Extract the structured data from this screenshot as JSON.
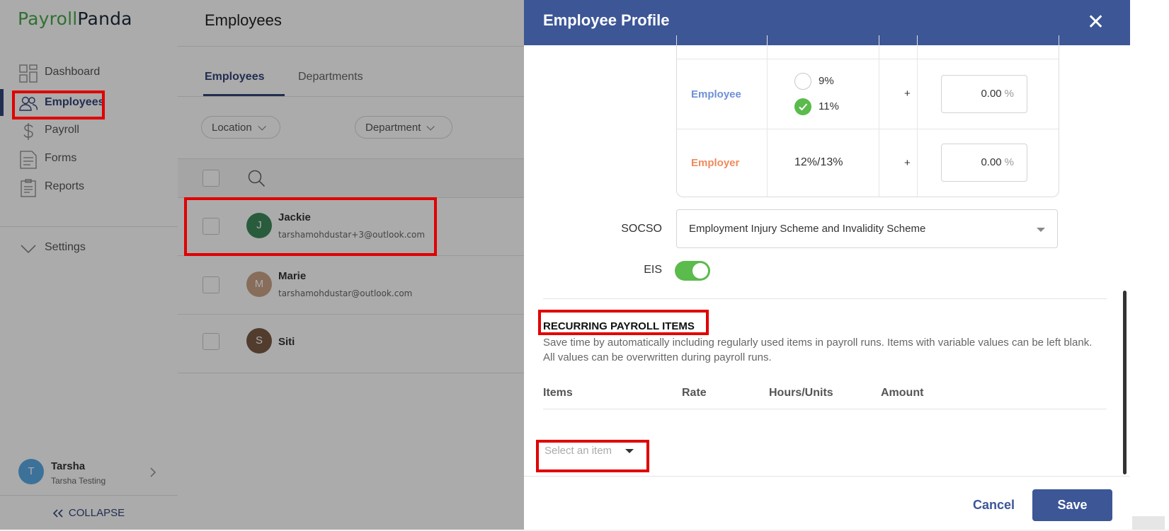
{
  "sidebar": {
    "logo_part1": "Payroll",
    "logo_part2": "Panda",
    "items": [
      {
        "label": "Dashboard"
      },
      {
        "label": "Employees"
      },
      {
        "label": "Payroll"
      },
      {
        "label": "Forms"
      },
      {
        "label": "Reports"
      }
    ],
    "settings_label": "Settings",
    "user": {
      "initial": "T",
      "name": "Tarsha",
      "org": "Tarsha Testing"
    },
    "collapse_label": "COLLAPSE"
  },
  "main": {
    "title": "Employees",
    "tabs": [
      {
        "label": "Employees"
      },
      {
        "label": "Departments"
      }
    ],
    "filters": [
      {
        "label": "Location"
      },
      {
        "label": "Department"
      }
    ],
    "employees": [
      {
        "initial": "J",
        "name": "Jackie",
        "email": "tarshamohdustar+3@outlook.com",
        "color": "#3c8a5a"
      },
      {
        "initial": "M",
        "name": "Marie",
        "email": "tarshamohdustar@outlook.com",
        "color": "#c9a386"
      },
      {
        "initial": "S",
        "name": "Siti",
        "email": "",
        "color": "#7a5a44"
      }
    ]
  },
  "panel": {
    "title": "Employee Profile",
    "epf": {
      "employee_label": "Employee",
      "employer_label": "Employer",
      "options": [
        {
          "label": "9%",
          "selected": false
        },
        {
          "label": "11%",
          "selected": true
        }
      ],
      "employer_rate": "12%/13%",
      "plus": "+",
      "employee_voluntary": "0.00",
      "employer_voluntary": "0.00",
      "pct": "%"
    },
    "socso_label": "SOCSO",
    "socso_value": "Employment Injury Scheme and Invalidity Scheme",
    "eis_label": "EIS",
    "eis_on": true,
    "recurring_title": "RECURRING PAYROLL ITEMS",
    "recurring_desc": "Save time by automatically including regularly used items in payroll runs. Items with variable values can be left blank. All values can be overwritten during payroll runs.",
    "columns": [
      "Items",
      "Rate",
      "Hours/Units",
      "Amount"
    ],
    "select_placeholder": "Select an item",
    "cancel_label": "Cancel",
    "save_label": "Save"
  },
  "colors": {
    "brand": "#3c5696",
    "green": "#5bbb4c",
    "employee": "#6f8fd8",
    "employer": "#f08a5d"
  }
}
